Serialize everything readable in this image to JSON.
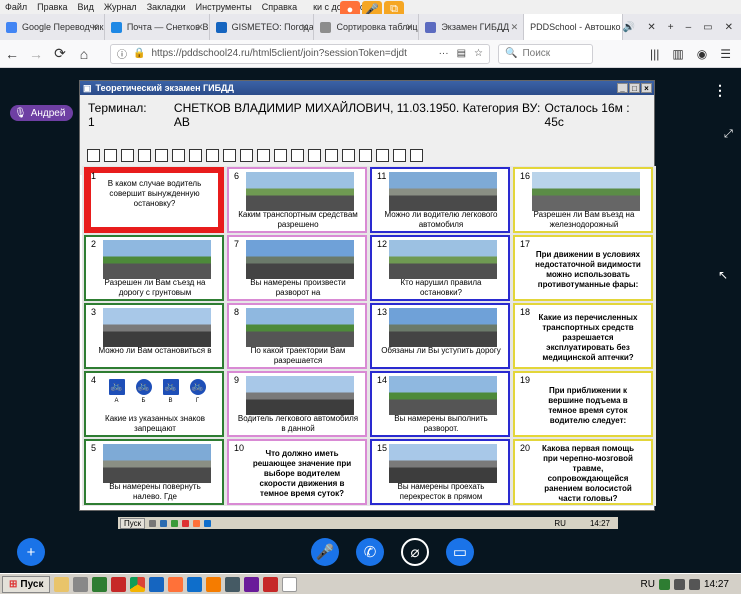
{
  "browser": {
    "menu": [
      "Файл",
      "Правка",
      "Вид",
      "Журнал",
      "Закладки",
      "Инструменты",
      "Справка"
    ],
    "menu_title_fragment": "ки с доступом",
    "tabs": [
      {
        "label": "Google Переводчик",
        "color": "#4285f4"
      },
      {
        "label": "Почта — Снетков В",
        "color": "#1e88e5"
      },
      {
        "label": "GISMETEO: Погода",
        "color": "#1565c0"
      },
      {
        "label": "Сортировка таблиц",
        "color": "#8d8d8d"
      },
      {
        "label": "Экзамен ГИБДД",
        "color": "#5c6bc0"
      },
      {
        "label": "PDDSchool - Автошко",
        "color": "#ffffff"
      }
    ],
    "url": "https://pddschool24.ru/html5client/join?sessionToken=djdt",
    "search_placeholder": "Поиск",
    "reader_icon": "reader-view-icon",
    "bookmark_icon": "star-icon"
  },
  "conference": {
    "user_name": "Андрей"
  },
  "exam": {
    "window_title": "Теоретический экзамен ГИБДД",
    "terminal": "Терминал: 1",
    "candidate": "СНЕТКОВ ВЛАДИМИР МИХАЙЛОВИЧ, 11.03.1950. Категория ВУ: АВ",
    "remaining": "Осталось 16м : 45с",
    "answer_boxes": 20,
    "questions": [
      {
        "n": "1",
        "text": "В каком случае водитель совершит вынужденную остановку?",
        "border": "#e81c1c",
        "type": "first"
      },
      {
        "n": "2",
        "text": "Разрешен ли Вам съезд на дорогу с грунтовым",
        "border": "#2e7d32",
        "type": "img"
      },
      {
        "n": "3",
        "text": "Можно ли Вам остановиться в",
        "border": "#2e7d32",
        "type": "img"
      },
      {
        "n": "4",
        "text": "Какие из указанных знаков запрещают",
        "border": "#2e7d32",
        "type": "signs"
      },
      {
        "n": "5",
        "text": "Вы намерены повернуть налево. Где",
        "border": "#2e7d32",
        "type": "img"
      },
      {
        "n": "6",
        "text": "Каким транспортным средствам разрешено",
        "border": "#d98ad4",
        "type": "img"
      },
      {
        "n": "7",
        "text": "Вы намерены произвести разворот на",
        "border": "#d98ad4",
        "type": "img"
      },
      {
        "n": "8",
        "text": "По какой траектории Вам разрешается",
        "border": "#d98ad4",
        "type": "img"
      },
      {
        "n": "9",
        "text": "Водитель легкового автомобиля в данной",
        "border": "#d98ad4",
        "type": "img"
      },
      {
        "n": "10",
        "text": "Что должно иметь решающее значение при выборе водителем скорости движения в темное время суток?",
        "border": "#d98ad4",
        "type": "text"
      },
      {
        "n": "11",
        "text": "Можно ли водителю легкового автомобиля",
        "border": "#2a2ad0",
        "type": "img"
      },
      {
        "n": "12",
        "text": "Кто нарушил правила остановки?",
        "border": "#2a2ad0",
        "type": "img"
      },
      {
        "n": "13",
        "text": "Обязаны ли Вы уступить дорогу",
        "border": "#2a2ad0",
        "type": "img"
      },
      {
        "n": "14",
        "text": "Вы намерены выполнить разворот.",
        "border": "#2a2ad0",
        "type": "img"
      },
      {
        "n": "15",
        "text": "Вы намерены проехать перекресток в прямом",
        "border": "#2a2ad0",
        "type": "img"
      },
      {
        "n": "16",
        "text": "Разрешен ли Вам въезд на железнодорожный",
        "border": "#e3d63a",
        "type": "img"
      },
      {
        "n": "17",
        "text": "При движении в условиях недостаточной видимости можно использовать противотуманные фары:",
        "border": "#e3d63a",
        "type": "text"
      },
      {
        "n": "18",
        "text": "Какие из перечисленных транспортных средств разрешается эксплуатировать без медицинской аптечки?",
        "border": "#e3d63a",
        "type": "text"
      },
      {
        "n": "19",
        "text": "При приближении к вершине подъема в темное время суток водителю следует:",
        "border": "#e3d63a",
        "type": "text"
      },
      {
        "n": "20",
        "text": "Какова первая помощь при черепно-мозговой травме, сопровождающейся ранением волосистой части головы?",
        "border": "#e3d63a",
        "type": "text"
      }
    ],
    "signs": [
      "А",
      "Б",
      "В",
      "Г"
    ]
  },
  "remote_tray": {
    "start": "Пуск",
    "lang": "RU",
    "time": "14:27"
  },
  "taskbar": {
    "start": "Пуск",
    "lang": "RU",
    "time": "14:27"
  }
}
